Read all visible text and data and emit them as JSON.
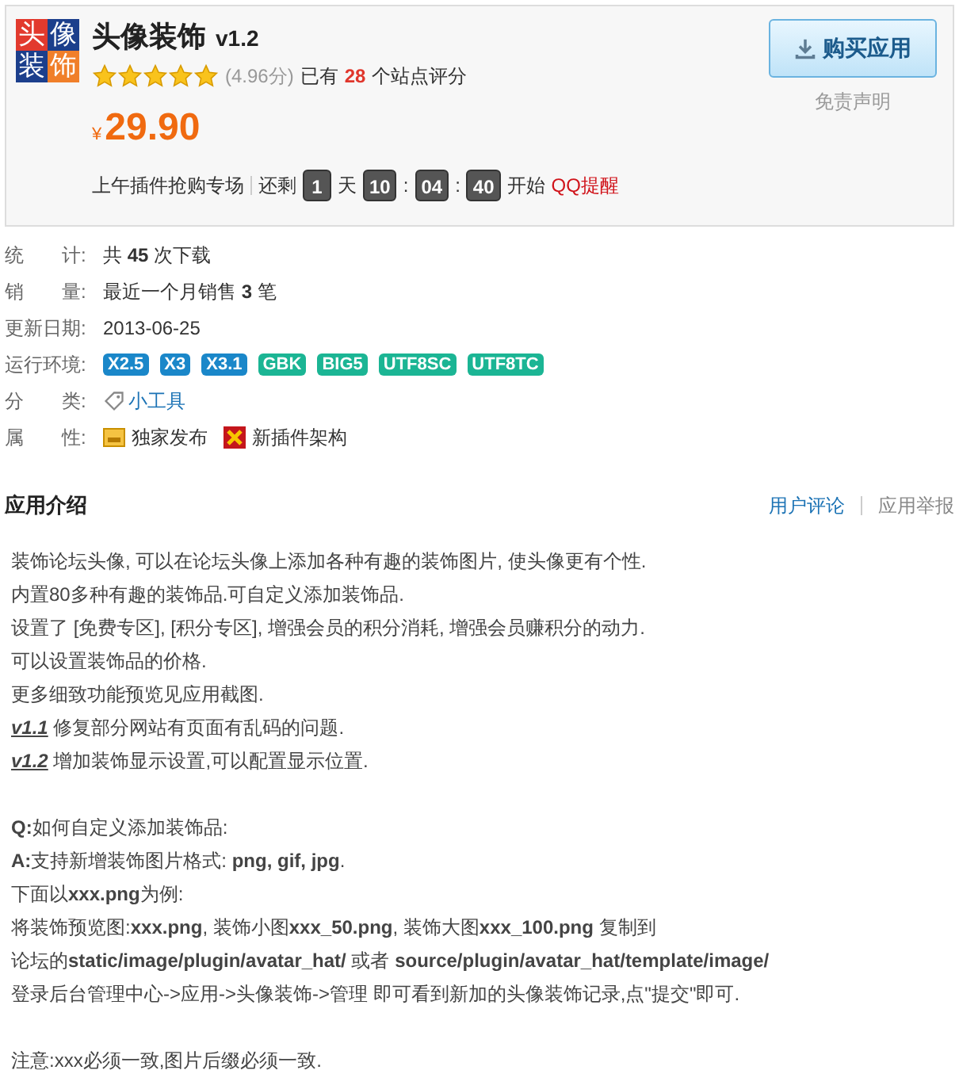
{
  "app": {
    "logo_chars": [
      "头",
      "像",
      "装",
      "饰"
    ],
    "title": "头像装饰",
    "version": "v1.2",
    "stars": 5,
    "score": "(4.96分)",
    "rating_prefix": "已有",
    "rating_count": "28",
    "rating_suffix": "个站点评分",
    "currency": "¥",
    "price": "29.90",
    "buy_button": "购买应用",
    "disclaimer": "免责声明"
  },
  "sale": {
    "label": "上午插件抢购专场",
    "remaining": "还剩",
    "parts": [
      {
        "kind": "box",
        "text": "1"
      },
      {
        "kind": "sep",
        "text": "天"
      },
      {
        "kind": "box",
        "text": "10"
      },
      {
        "kind": "sep",
        "text": ":"
      },
      {
        "kind": "box",
        "text": "04"
      },
      {
        "kind": "sep",
        "text": ":"
      },
      {
        "kind": "box",
        "text": "40"
      }
    ],
    "start": "开始",
    "remind_link": "QQ提醒"
  },
  "details": [
    {
      "kind": "text",
      "label": "统　　计:",
      "value": "共 **45** 次下载"
    },
    {
      "kind": "text",
      "label": "销　　量:",
      "value": "最近一个月销售 **3** 笔"
    },
    {
      "kind": "text",
      "label": "更新日期:",
      "value": "2013-06-25"
    },
    {
      "kind": "tags",
      "label": "运行环境:",
      "tags": [
        {
          "text": "X2.5",
          "color": "#1a87c9"
        },
        {
          "text": "X3",
          "color": "#1a87c9"
        },
        {
          "text": "X3.1",
          "color": "#1a87c9"
        },
        {
          "text": "GBK",
          "color": "#1bb594"
        },
        {
          "text": "BIG5",
          "color": "#1bb594"
        },
        {
          "text": "UTF8SC",
          "color": "#1bb594"
        },
        {
          "text": "UTF8TC",
          "color": "#1bb594"
        }
      ]
    },
    {
      "kind": "category",
      "label": "分　　类:",
      "category": "小工具"
    },
    {
      "kind": "attributes",
      "label": "属　　性:",
      "attributes": [
        {
          "kind": "exclusive",
          "text": "独家发布"
        },
        {
          "kind": "new-arch",
          "text": "新插件架构"
        }
      ]
    }
  ],
  "intro": {
    "title": "应用介绍",
    "links": [
      "用户评论",
      "应用举报"
    ],
    "lines": [
      {
        "kind": "text",
        "text": "装饰论坛头像, 可以在论坛头像上添加各种有趣的装饰图片, 使头像更有个性."
      },
      {
        "kind": "text",
        "text": "内置80多种有趣的装饰品.可自定义添加装饰品."
      },
      {
        "kind": "text",
        "text": "设置了 [免费专区], [积分专区], 增强会员的积分消耗, 增强会员赚积分的动力."
      },
      {
        "kind": "text",
        "text": "可以设置装饰品的价格."
      },
      {
        "kind": "text",
        "text": "更多细致功能预览见应用截图."
      },
      {
        "kind": "version",
        "version": "v1.1",
        "text": "修复部分网站有页面有乱码的问题."
      },
      {
        "kind": "version",
        "version": "v1.2",
        "text": "增加装饰显示设置,可以配置显示位置."
      },
      {
        "kind": "blank"
      },
      {
        "kind": "text",
        "text": "**Q:**如何自定义添加装饰品:"
      },
      {
        "kind": "text",
        "text": "**A:**支持新增装饰图片格式: **png, gif, jpg**."
      },
      {
        "kind": "text",
        "text": "下面以**xxx.png**为例:"
      },
      {
        "kind": "text",
        "text": "将装饰预览图:**xxx.png**, 装饰小图**xxx_50.png**, 装饰大图**xxx_100.png** 复制到"
      },
      {
        "kind": "text",
        "text": "论坛的**static/image/plugin/avatar_hat/** 或者 **source/plugin/avatar_hat/template/image/**"
      },
      {
        "kind": "text",
        "text": "登录后台管理中心->应用->头像装饰->管理 即可看到新加的头像装饰记录,点\"提交\"即可."
      },
      {
        "kind": "blank"
      },
      {
        "kind": "text",
        "text": "注意:xxx必须一致,图片后缀必须一致."
      }
    ]
  }
}
